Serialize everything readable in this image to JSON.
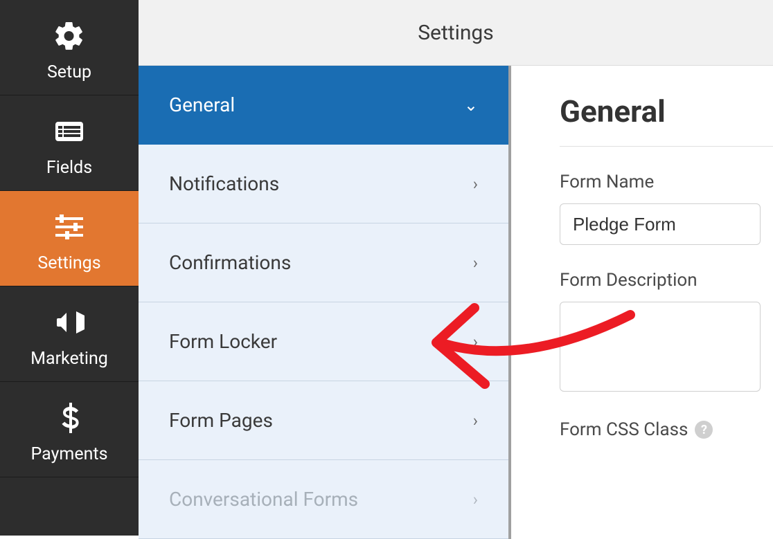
{
  "topbar": {
    "title": "Settings"
  },
  "nav": {
    "items": [
      {
        "label": "Setup"
      },
      {
        "label": "Fields"
      },
      {
        "label": "Settings"
      },
      {
        "label": "Marketing"
      },
      {
        "label": "Payments"
      }
    ]
  },
  "settings_panel": {
    "items": [
      {
        "label": "General"
      },
      {
        "label": "Notifications"
      },
      {
        "label": "Confirmations"
      },
      {
        "label": "Form Locker"
      },
      {
        "label": "Form Pages"
      },
      {
        "label": "Conversational Forms"
      }
    ]
  },
  "main": {
    "heading": "General",
    "form_name_label": "Form Name",
    "form_name_value": "Pledge Form",
    "form_description_label": "Form Description",
    "form_description_value": "",
    "form_css_class_label": "Form CSS Class"
  }
}
